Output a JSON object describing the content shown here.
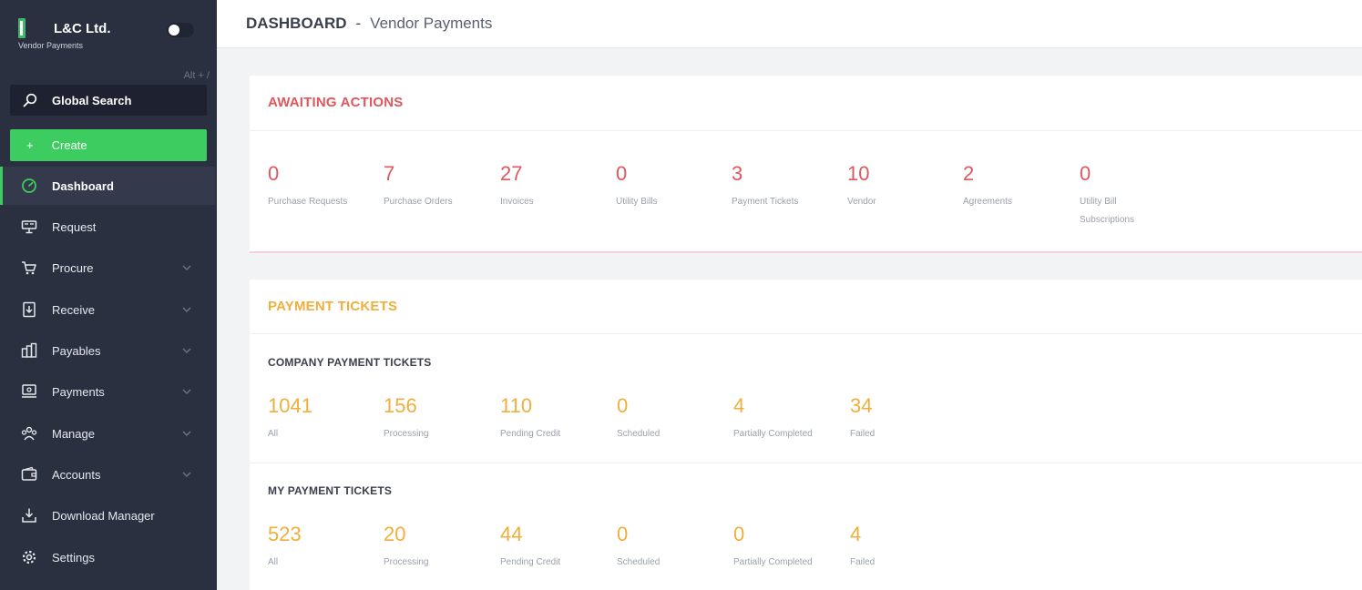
{
  "brand": {
    "title": "L&C Ltd.",
    "subtitle": "Vendor Payments"
  },
  "sidebar": {
    "shortcut": "Alt + /",
    "search_label": "Global Search",
    "create_label": "Create",
    "create_plus": "+",
    "items": [
      {
        "label": "Dashboard",
        "icon": "dashboard-icon",
        "active": true,
        "expandable": false
      },
      {
        "label": "Request",
        "icon": "request-icon",
        "active": false,
        "expandable": false
      },
      {
        "label": "Procure",
        "icon": "cart-icon",
        "active": false,
        "expandable": true
      },
      {
        "label": "Receive",
        "icon": "receive-icon",
        "active": false,
        "expandable": true
      },
      {
        "label": "Payables",
        "icon": "payables-icon",
        "active": false,
        "expandable": true
      },
      {
        "label": "Payments",
        "icon": "payments-icon",
        "active": false,
        "expandable": true
      },
      {
        "label": "Manage",
        "icon": "manage-icon",
        "active": false,
        "expandable": true
      },
      {
        "label": "Accounts",
        "icon": "wallet-icon",
        "active": false,
        "expandable": true
      },
      {
        "label": "Download Manager",
        "icon": "download-icon",
        "active": false,
        "expandable": false
      },
      {
        "label": "Settings",
        "icon": "gear-icon",
        "active": false,
        "expandable": false
      }
    ]
  },
  "header": {
    "title": "DASHBOARD",
    "separator": "-",
    "subtitle": "Vendor Payments"
  },
  "awaiting": {
    "title": "AWAITING ACTIONS",
    "stats": [
      {
        "value": "0",
        "label": "Purchase Requests"
      },
      {
        "value": "7",
        "label": "Purchase Orders"
      },
      {
        "value": "27",
        "label": "Invoices"
      },
      {
        "value": "0",
        "label": "Utility Bills"
      },
      {
        "value": "3",
        "label": "Payment Tickets"
      },
      {
        "value": "10",
        "label": "Vendor"
      },
      {
        "value": "2",
        "label": "Agreements"
      },
      {
        "value": "0",
        "label": "Utility Bill Subscriptions"
      }
    ]
  },
  "payment_tickets": {
    "title": "PAYMENT TICKETS",
    "company": {
      "title": "COMPANY PAYMENT TICKETS",
      "stats": [
        {
          "value": "1041",
          "label": "All"
        },
        {
          "value": "156",
          "label": "Processing"
        },
        {
          "value": "110",
          "label": "Pending Credit"
        },
        {
          "value": "0",
          "label": "Scheduled"
        },
        {
          "value": "4",
          "label": "Partially Completed"
        },
        {
          "value": "34",
          "label": "Failed"
        }
      ]
    },
    "mine": {
      "title": "MY PAYMENT TICKETS",
      "stats": [
        {
          "value": "523",
          "label": "All"
        },
        {
          "value": "20",
          "label": "Processing"
        },
        {
          "value": "44",
          "label": "Pending Credit"
        },
        {
          "value": "0",
          "label": "Scheduled"
        },
        {
          "value": "0",
          "label": "Partially Completed"
        },
        {
          "value": "4",
          "label": "Failed"
        }
      ]
    }
  },
  "colors": {
    "sidebar_bg": "#2b3040",
    "accent_green": "#3dcc5f",
    "awaiting_red": "#e0565d",
    "tickets_orange": "#f0ae3c"
  }
}
